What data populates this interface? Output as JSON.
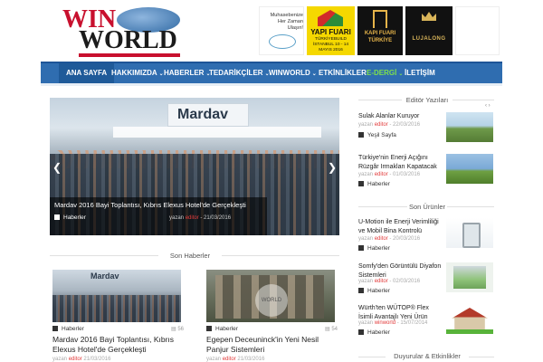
{
  "header": {
    "logo_top": "WIN",
    "logo_bottom": "WORLD",
    "ads": [
      {
        "text": "Muhasebenize Her Zaman Ulaşın!"
      },
      {
        "title": "YAPI FUARI",
        "sub": "TÜRKİYEBUILD İSTANBUL 10 - 14 MAYIS 2016"
      },
      {
        "text": "KAPI FUARI TÜRKİYE"
      },
      {
        "text": "LUJALONG"
      }
    ]
  },
  "nav": {
    "items": [
      {
        "label": "ANA SAYFA",
        "chev": ""
      },
      {
        "label": "HAKKIMIZDA",
        "chev": "⌄"
      },
      {
        "label": "HABERLER",
        "chev": "⌄"
      },
      {
        "label": "TEDARİKÇİLER",
        "chev": "⌄"
      },
      {
        "label": "WINWORLD",
        "chev": "⌄"
      },
      {
        "label": "ETKİNLİKLER",
        "chev": ""
      },
      {
        "label": "E-DERGİ",
        "chev": "⌄"
      },
      {
        "label": "İLETİŞİM",
        "chev": ""
      }
    ]
  },
  "slider": {
    "banner": "Mardav",
    "caption": "Mardav 2016 Bayi Toplantısı, Kıbrıs Elexus Hotel'de Gerçekleşti",
    "category": "Haberler",
    "meta_prefix": "yazan",
    "author": "editor",
    "date": "- 21/03/2016"
  },
  "sections": {
    "son_haberler": "Son Haberler",
    "editor_yazilari": "Editör Yazıları",
    "son_urunler": "Son Ürünler",
    "duyurular": "Duyurular & Etkinlikler"
  },
  "news": [
    {
      "img_label": "Mardav",
      "category": "Haberler",
      "stats": "▤ 56",
      "title": "Mardav 2016 Bayi Toplantısı, Kıbrıs Elexus Hotel'de Gerçekleşti",
      "meta_prefix": "yazan",
      "author": "editor",
      "date": "21/03/2016"
    },
    {
      "img_label": "WORLD",
      "category": "Haberler",
      "stats": "▤ 54",
      "title": "Egepen Deceuninck'in Yeni Nesil Panjur Sistemleri",
      "meta_prefix": "yazan",
      "author": "editor",
      "date": "21/03/2016"
    }
  ],
  "sidebar": {
    "nav": "‹ ›",
    "editor_items": [
      {
        "title": "Sulak Alanlar Kuruyor",
        "meta_prefix": "yazan",
        "author": "editor",
        "date": "- 22/03/2016",
        "category": "Yeşil Sayfa"
      },
      {
        "title": "Türkiye'nin Enerji Açığını Rüzgâr Irmakları Kapatacak",
        "meta_prefix": "yazan",
        "author": "editor",
        "date": "- 01/03/2016",
        "category": "Haberler"
      }
    ],
    "product_items": [
      {
        "title": "U-Motion ile Enerji Verimliliği ve Mobil Bina Kontrolü",
        "meta_prefix": "yazan",
        "author": "editor",
        "date": "- 20/03/2016",
        "category": "Haberler"
      },
      {
        "title": "Somfy'den Görüntülü Diyafon Sistemleri",
        "meta_prefix": "yazan",
        "author": "editor",
        "date": "- 02/03/2016",
        "category": "Haberler"
      },
      {
        "title": "Würth'ten WÜTOP® Flex İsimli Avantajlı Yeni Ürün",
        "meta_prefix": "yazan",
        "author": "winworld",
        "date": "- 15/07/2014",
        "category": "Haberler"
      }
    ]
  }
}
